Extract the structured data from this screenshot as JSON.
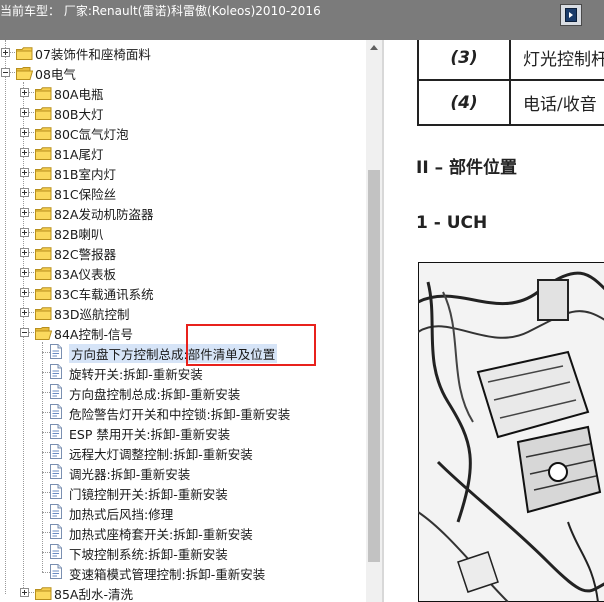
{
  "window": {
    "title": "当前车型：  厂家:Renault(雷诺)科雷傲(Koleos)2010-2016"
  },
  "tree": {
    "items": [
      {
        "label": "07装饰件和座椅面料",
        "kind": "folder",
        "state": "closed"
      },
      {
        "label": "08电气",
        "kind": "folder",
        "state": "open"
      },
      {
        "label": "80A电瓶",
        "kind": "folder",
        "state": "closed"
      },
      {
        "label": "80B大灯",
        "kind": "folder",
        "state": "closed"
      },
      {
        "label": "80C氙气灯泡",
        "kind": "folder",
        "state": "closed"
      },
      {
        "label": "81A尾灯",
        "kind": "folder",
        "state": "closed"
      },
      {
        "label": "81B室内灯",
        "kind": "folder",
        "state": "closed"
      },
      {
        "label": "81C保险丝",
        "kind": "folder",
        "state": "closed"
      },
      {
        "label": "82A发动机防盗器",
        "kind": "folder",
        "state": "closed"
      },
      {
        "label": "82B喇叭",
        "kind": "folder",
        "state": "closed"
      },
      {
        "label": "82C警报器",
        "kind": "folder",
        "state": "closed"
      },
      {
        "label": "83A仪表板",
        "kind": "folder",
        "state": "closed"
      },
      {
        "label": "83C车载通讯系统",
        "kind": "folder",
        "state": "closed"
      },
      {
        "label": "83D巡航控制",
        "kind": "folder",
        "state": "closed"
      },
      {
        "label": "84A控制-信号",
        "kind": "folder",
        "state": "open"
      },
      {
        "label": "方向盘下方控制总成:部件清单及位置",
        "kind": "page",
        "selected": true
      },
      {
        "label": "旋转开关:拆卸-重新安装",
        "kind": "page"
      },
      {
        "label": "方向盘控制总成:拆卸-重新安装",
        "kind": "page"
      },
      {
        "label": "危险警告灯开关和中控锁:拆卸-重新安装",
        "kind": "page"
      },
      {
        "label": "ESP 禁用开关:拆卸-重新安装",
        "kind": "page"
      },
      {
        "label": "远程大灯调整控制:拆卸-重新安装",
        "kind": "page"
      },
      {
        "label": "调光器:拆卸-重新安装",
        "kind": "page"
      },
      {
        "label": "门镜控制开关:拆卸-重新安装",
        "kind": "page"
      },
      {
        "label": "加热式后风挡:修理",
        "kind": "page"
      },
      {
        "label": "加热式座椅套开关:拆卸-重新安装",
        "kind": "page"
      },
      {
        "label": "下坡控制系统:拆卸-重新安装",
        "kind": "page"
      },
      {
        "label": "变速箱模式管理控制:拆卸-重新安装",
        "kind": "page"
      },
      {
        "label": "85A刮水-清洗",
        "kind": "folder",
        "state": "closed"
      }
    ]
  },
  "document": {
    "table": [
      {
        "num": "(3)",
        "text": "灯光控制杆"
      },
      {
        "num": "(4)",
        "text": "电话/收音"
      }
    ],
    "section_heading": "II – 部件位置",
    "sub_heading": "1 - UCH"
  },
  "colors": {
    "titlebar": "#7b7b7b",
    "selection": "#d6e4f7",
    "highlight_box": "#e8211c",
    "folder": "#f5cd4f"
  }
}
